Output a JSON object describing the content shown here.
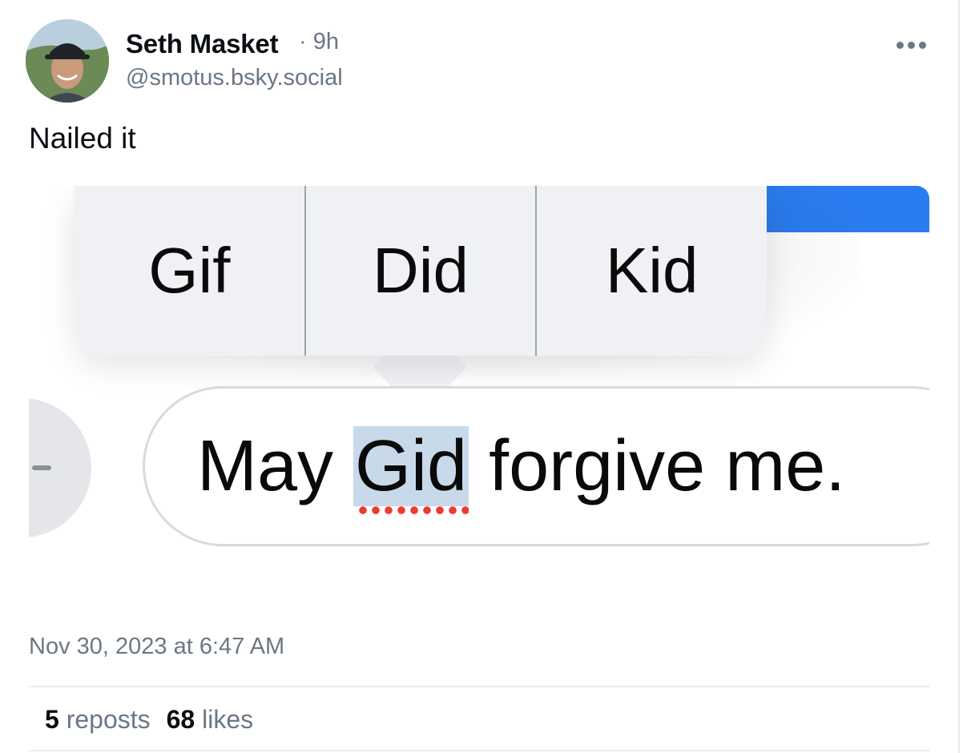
{
  "post": {
    "author_name": "Seth Masket",
    "age": "· 9h",
    "handle": "@smotus.bsky.social",
    "text": "Nailed it",
    "timestamp": "Nov 30, 2023 at 6:47 AM",
    "menu_icon": "more-horizontal-icon"
  },
  "embed": {
    "suggestions": [
      "Gif",
      "Did",
      "Kid"
    ],
    "message_before": "May ",
    "message_typo": "Gid",
    "message_after": " forgive me.",
    "colors": {
      "bubble": "#2b7cf0",
      "highlight": "#c8d9ea",
      "typo_underline": "#ec3a32"
    }
  },
  "stats": {
    "reposts_count": "5",
    "reposts_label": "reposts",
    "likes_count": "68",
    "likes_label": "likes"
  }
}
